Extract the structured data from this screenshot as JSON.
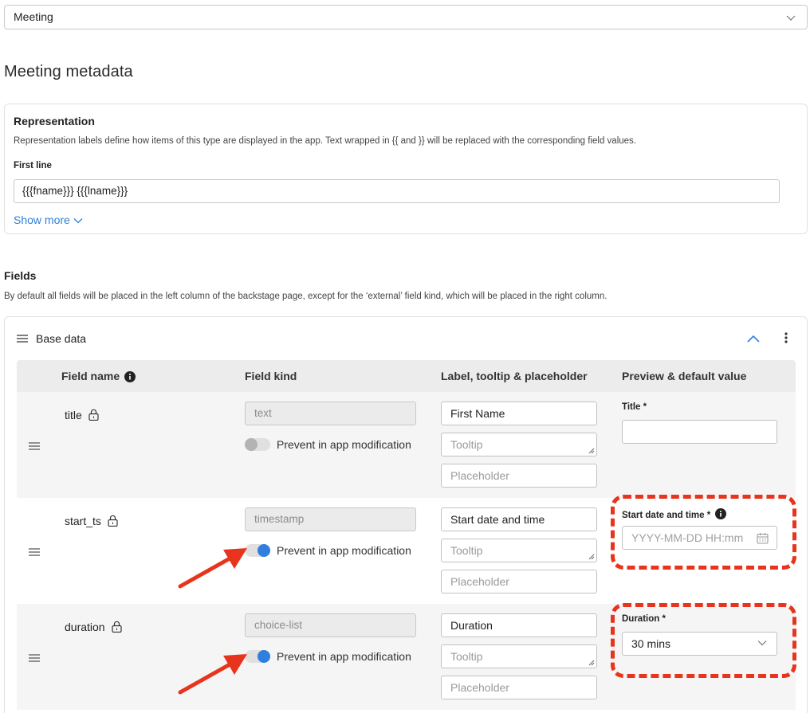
{
  "type_select": {
    "value": "Meeting"
  },
  "page_title": "Meeting metadata",
  "representation": {
    "title": "Representation",
    "description": "Representation labels define how items of this type are displayed in the app. Text wrapped in {{ and }} will be replaced with the corresponding field values.",
    "first_line_label": "First line",
    "first_line_value": "{{{fname}}} {{{lname}}}",
    "show_more": "Show more"
  },
  "fields": {
    "title": "Fields",
    "description": "By default all fields will be placed in the left column of the backstage page, except for the ‘external’ field kind, which will be placed in the right column."
  },
  "base_data": {
    "title": "Base data",
    "columns": [
      "Field name",
      "Field kind",
      "Label, tooltip & placeholder",
      "Preview & default value"
    ],
    "rows": [
      {
        "field_name": "title",
        "field_kind": "text",
        "prevent_modification": false,
        "toggle_label": "Prevent in app modification",
        "label": "First Name",
        "tooltip_placeholder": "Tooltip",
        "placeholder_placeholder": "Placeholder",
        "preview_label": "Title *",
        "preview_value": ""
      },
      {
        "field_name": "start_ts",
        "field_kind": "timestamp",
        "prevent_modification": true,
        "toggle_label": "Prevent in app modification",
        "label": "Start date and time",
        "tooltip_placeholder": "Tooltip",
        "placeholder_placeholder": "Placeholder",
        "preview_label": "Start date and time *",
        "preview_placeholder": "YYYY-MM-DD HH:mm"
      },
      {
        "field_name": "duration",
        "field_kind": "choice-list",
        "prevent_modification": true,
        "toggle_label": "Prevent in app modification",
        "label": "Duration",
        "tooltip_placeholder": "Tooltip",
        "placeholder_placeholder": "Placeholder",
        "preview_label": "Duration *",
        "preview_value": "30 mins"
      }
    ]
  },
  "colors": {
    "accent": "#2e7fe0",
    "link": "#2f7fd8",
    "annotation": "#e8341c"
  },
  "icons": [
    "chevron-down-icon",
    "drag-handle-icon",
    "chevron-up-icon",
    "more-vertical-icon",
    "info-icon",
    "lock-icon",
    "calendar-icon"
  ]
}
